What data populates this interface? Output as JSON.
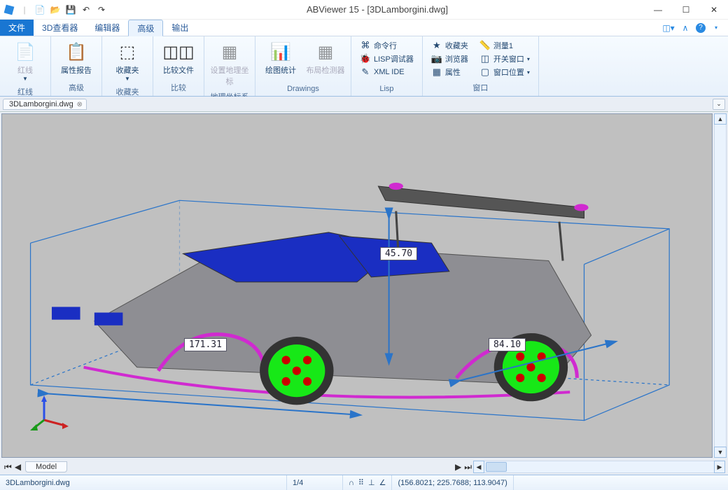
{
  "titlebar": {
    "title": "ABViewer 15 - [3DLamborgini.dwg]"
  },
  "tabs": {
    "file": "文件",
    "items": [
      "3D查看器",
      "编辑器",
      "高级",
      "输出"
    ],
    "active_index": 2
  },
  "ribbon": {
    "groups": [
      {
        "caption": "红线",
        "big": [
          {
            "label": "红线",
            "drop": true,
            "disabled": true
          }
        ]
      },
      {
        "caption": "高级",
        "big": [
          {
            "label": "属性报告"
          }
        ]
      },
      {
        "caption": "收藏夹",
        "big": [
          {
            "label": "收藏夹",
            "drop": true
          }
        ]
      },
      {
        "caption": "比较",
        "big": [
          {
            "label": "比较文件"
          }
        ]
      },
      {
        "caption": "地理坐标系",
        "big": [
          {
            "label": "设置地理坐标",
            "disabled": true
          }
        ]
      },
      {
        "caption": "Drawings",
        "big": [
          {
            "label": "绘图统计"
          },
          {
            "label": "布局检测器",
            "disabled": true
          }
        ]
      },
      {
        "caption": "Lisp",
        "small": [
          {
            "icon": "⌘",
            "label": "命令行"
          },
          {
            "icon": "🐞",
            "label": "LISP调试器"
          },
          {
            "icon": "✎",
            "label": "XML IDE"
          }
        ]
      },
      {
        "caption": "窗口",
        "colA": [
          {
            "icon": "★",
            "label": "收藏夹"
          },
          {
            "icon": "📷",
            "label": "浏览器"
          },
          {
            "icon": "▦",
            "label": "属性"
          }
        ],
        "colB": [
          {
            "icon": "📏",
            "label": "测量1"
          },
          {
            "icon": "◫",
            "label": "开关窗口",
            "drop": true
          },
          {
            "icon": "▢",
            "label": "窗口位置",
            "drop": true
          }
        ]
      }
    ]
  },
  "document_tab": {
    "name": "3DLamborgini.dwg"
  },
  "dimensions": {
    "length": "171.31",
    "height": "45.70",
    "width": "84.10"
  },
  "bottom_tab": {
    "model": "Model"
  },
  "statusbar": {
    "filename": "3DLamborgini.dwg",
    "page": "1/4",
    "coords": "(156.8021; 225.7688; 113.9047)"
  }
}
